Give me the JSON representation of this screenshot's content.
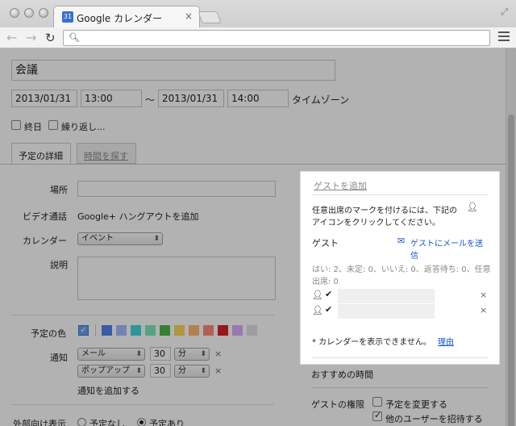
{
  "browser": {
    "tab_title": "Google カレンダー",
    "tab_close": "×",
    "favicon_text": "31"
  },
  "event": {
    "title": "会議",
    "start_date": "2013/01/31",
    "start_time": "13:00",
    "separator": "〜",
    "end_date": "2013/01/31",
    "end_time": "14:00",
    "timezone_link": "タイムゾーン",
    "all_day_label": "終日",
    "repeat_label": "繰り返し..."
  },
  "tabs": {
    "details": "予定の詳細",
    "find_time": "時間を探す"
  },
  "form": {
    "location_label": "場所",
    "video_label": "ビデオ通話",
    "video_link": "Google+ ハングアウトを追加",
    "calendar_label": "カレンダー",
    "calendar_value": "イベント",
    "description_label": "説明",
    "color_label": "予定の色",
    "colors": [
      "#5484ed",
      "#a4bdfc",
      "#46d6db",
      "#7ae7bf",
      "#51b749",
      "#fbd75b",
      "#ffb878",
      "#ff887c",
      "#dc2127",
      "#dbadff",
      "#e1e1e1"
    ],
    "default_color": "#6d9eeb",
    "notify_label": "通知",
    "notifications": [
      {
        "method": "メール",
        "amount": "30",
        "unit": "分",
        "remove": "×"
      },
      {
        "method": "ポップアップ",
        "amount": "30",
        "unit": "分",
        "remove": "×"
      }
    ],
    "add_notification": "通知を追加する",
    "visibility_label": "外部向け表示",
    "visibility_none": "予定なし",
    "visibility_busy": "予定あり"
  },
  "guests_side": {
    "suggested_times": "おすすめの時間",
    "permissions_label": "ゲストの権限",
    "perm_modify": "予定を変更する",
    "perm_invite": "他のユーザーを招待する"
  },
  "popup": {
    "add_guest_placeholder": "ゲストを追加",
    "optional_hint_1": "任意出席のマークを付けるには、下記の",
    "optional_hint_2": "アイコンをクリックしてください。",
    "guests_header": "ゲスト",
    "email_guests_1": "ゲストにメールを送",
    "email_guests_2": "信",
    "rsvp_1": "はい: 2、未定: 0、いいえ: 0、返答待ち: 0、任意",
    "rsvp_2": "出席: 0",
    "guest_remove": "×",
    "cannot_show": "* カレンダーを表示できません。",
    "reason_link": "理由"
  }
}
